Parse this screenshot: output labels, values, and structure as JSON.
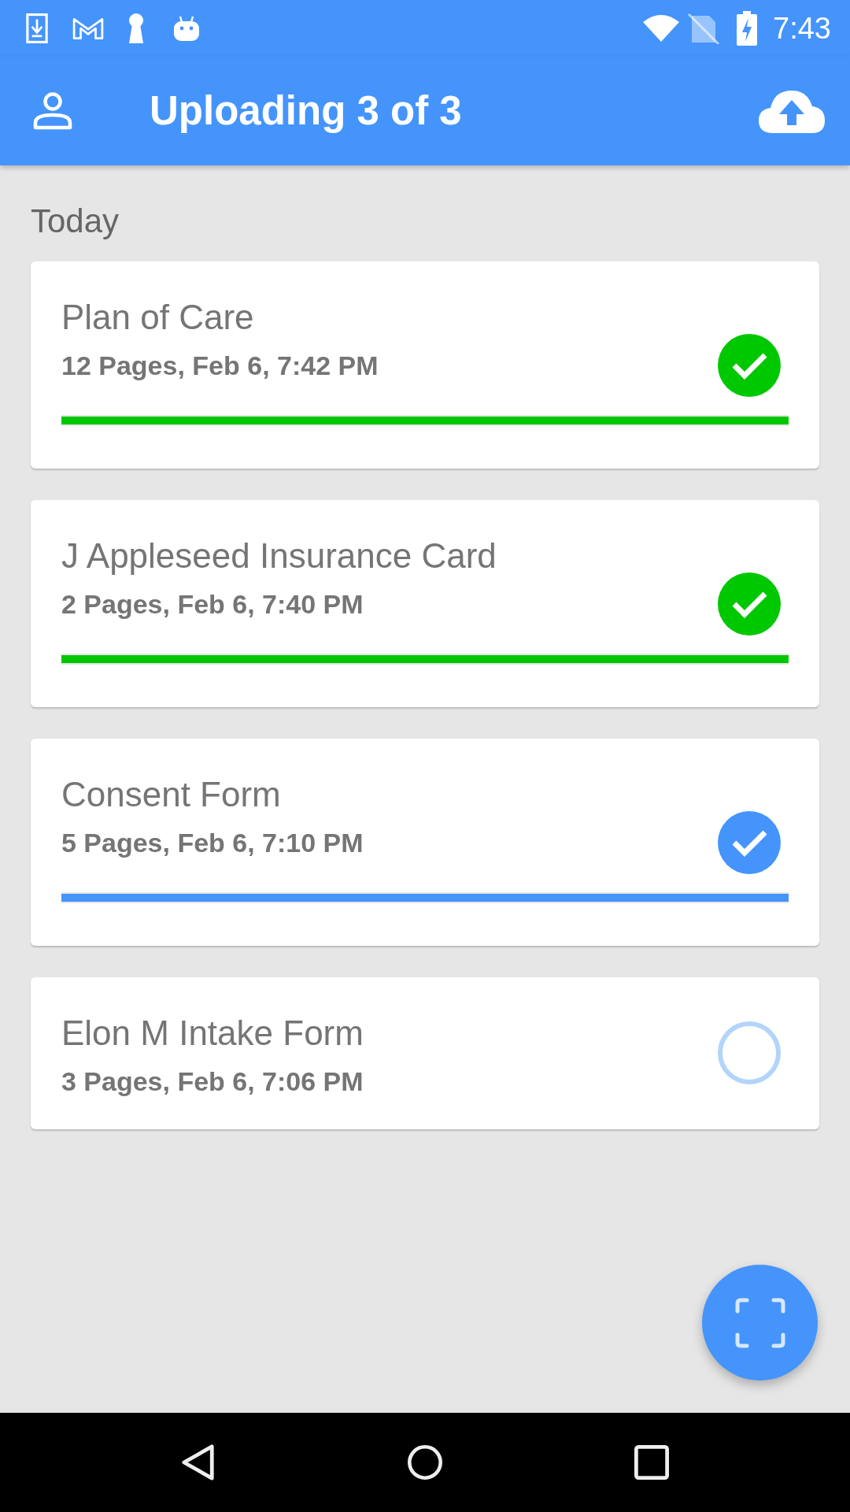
{
  "status_bar": {
    "time": "7:43"
  },
  "app_bar": {
    "title": "Uploading 3 of 3"
  },
  "section": {
    "title": "Today"
  },
  "documents": [
    {
      "title": "Plan of Care",
      "details": "12 Pages, Feb 6, 7:42 PM",
      "kind": "check",
      "color": "#00c800",
      "level": 1
    },
    {
      "title": "J Appleseed Insurance Card",
      "details": "2 Pages, Feb 6, 7:40 PM",
      "kind": "check",
      "color": "#00c800",
      "level": 1
    },
    {
      "title": "Consent Form",
      "details": "5 Pages, Feb 6, 7:10 PM",
      "kind": "check",
      "color": "#4494fc",
      "level": 1
    },
    {
      "title": "Elon M Intake Form",
      "details": "3 Pages, Feb 6, 7:06 PM",
      "kind": "ring",
      "color": "#b3d4fb"
    }
  ]
}
